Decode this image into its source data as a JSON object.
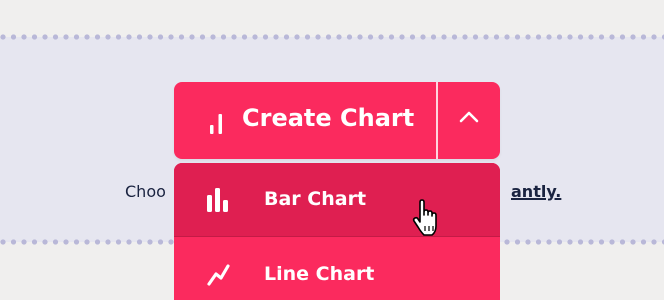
{
  "colors": {
    "primary": "#fb2a5e",
    "menu_hover": "#df1f51",
    "text_dark": "#1a2340",
    "band": "#e6e6f0",
    "dots": "#b9b8d8"
  },
  "split_button": {
    "icon": "bar-chart-icon",
    "label": "Create Chart",
    "toggle_icon": "chevron-up-icon"
  },
  "menu": {
    "items": [
      {
        "label": "Bar Chart",
        "icon": "bar-chart-icon",
        "state": "hovered"
      },
      {
        "label": "Line Chart",
        "icon": "line-chart-icon"
      }
    ]
  },
  "helper": {
    "left_text": "Choo",
    "right_text": "antly."
  },
  "cursor": {
    "icon": "hand-pointer-icon"
  }
}
